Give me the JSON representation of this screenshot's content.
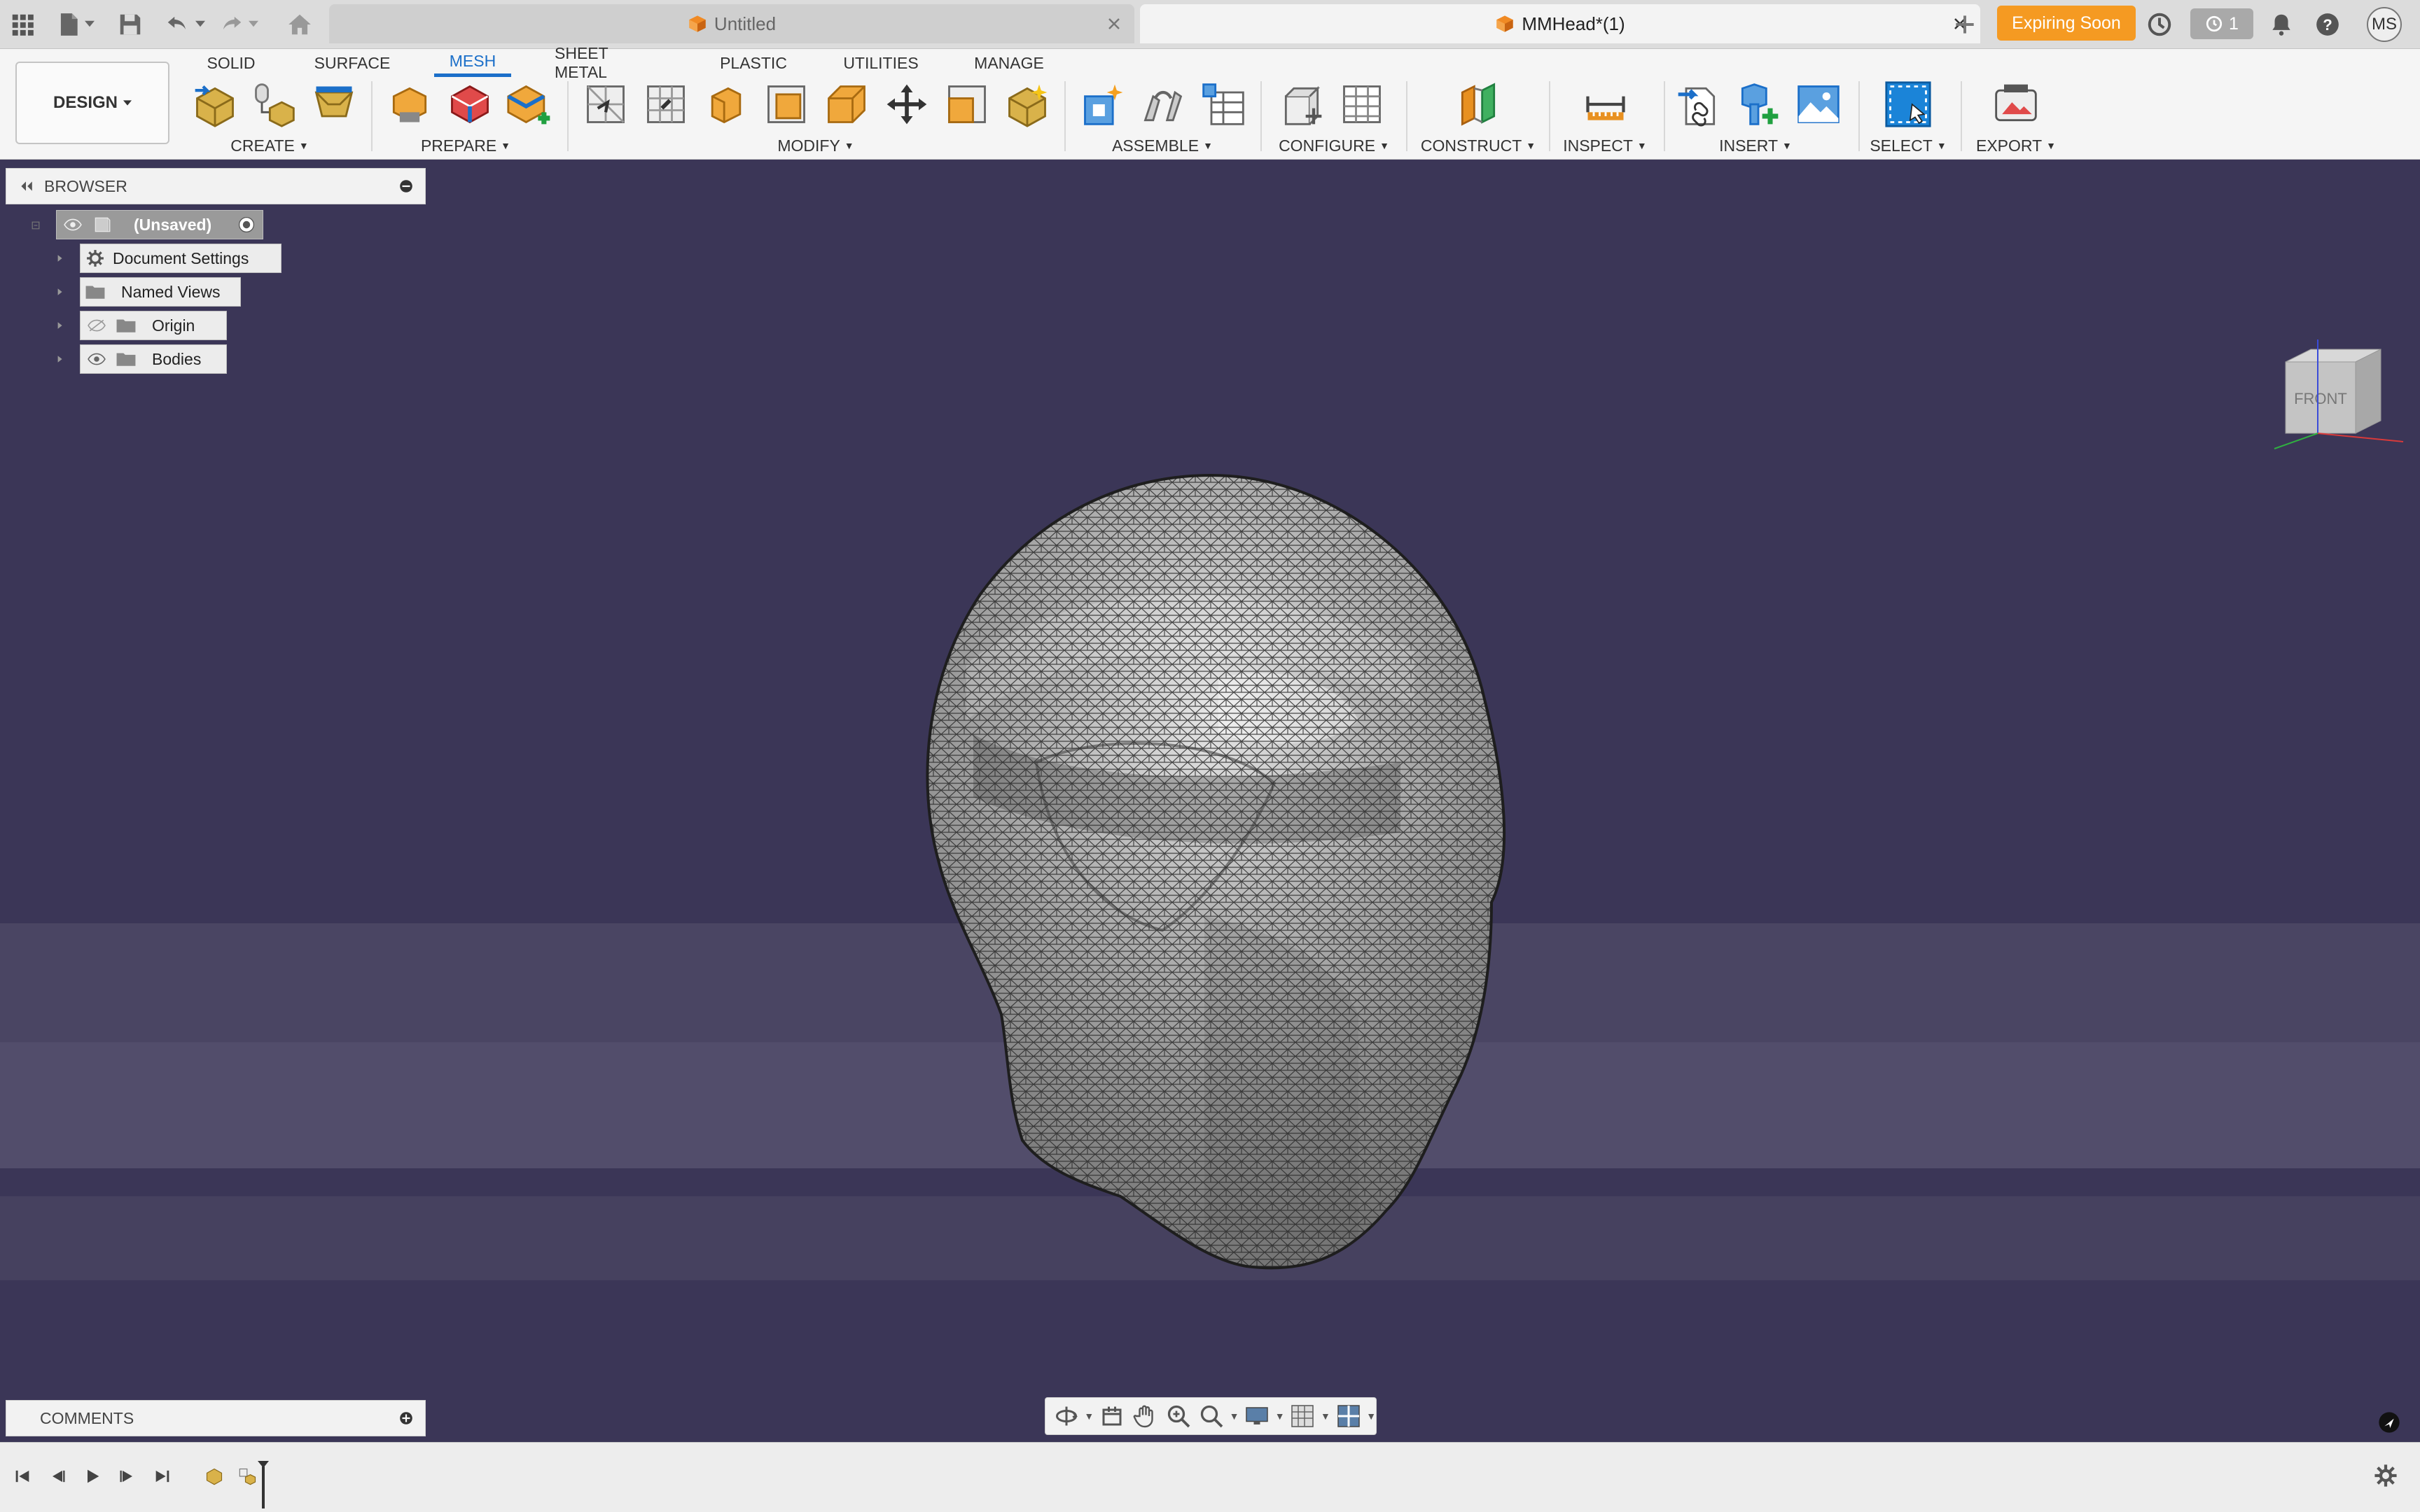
{
  "titlebar": {
    "tabs": [
      {
        "label": "Untitled",
        "active": false
      },
      {
        "label": "MMHead*(1)",
        "active": true
      }
    ],
    "expiring_label": "Expiring Soon",
    "jobs_count": "1",
    "user_initials": "MS"
  },
  "workspace": {
    "label": "DESIGN"
  },
  "ribbon": {
    "tabs": [
      "SOLID",
      "SURFACE",
      "MESH",
      "SHEET METAL",
      "PLASTIC",
      "UTILITIES",
      "MANAGE"
    ],
    "active_tab": "MESH",
    "groups": [
      "CREATE",
      "PREPARE",
      "MODIFY",
      "ASSEMBLE",
      "CONFIGURE",
      "CONSTRUCT",
      "INSPECT",
      "INSERT",
      "SELECT",
      "EXPORT"
    ]
  },
  "browser": {
    "title": "BROWSER",
    "root": "(Unsaved)",
    "items": [
      "Document Settings",
      "Named Views",
      "Origin",
      "Bodies"
    ]
  },
  "comments": {
    "title": "COMMENTS"
  },
  "viewcube": {
    "face_label": "FRONT"
  },
  "colors": {
    "accent": "#1b6fc9",
    "expiring": "#f59a22",
    "viewport_bg": "#3b3657"
  }
}
